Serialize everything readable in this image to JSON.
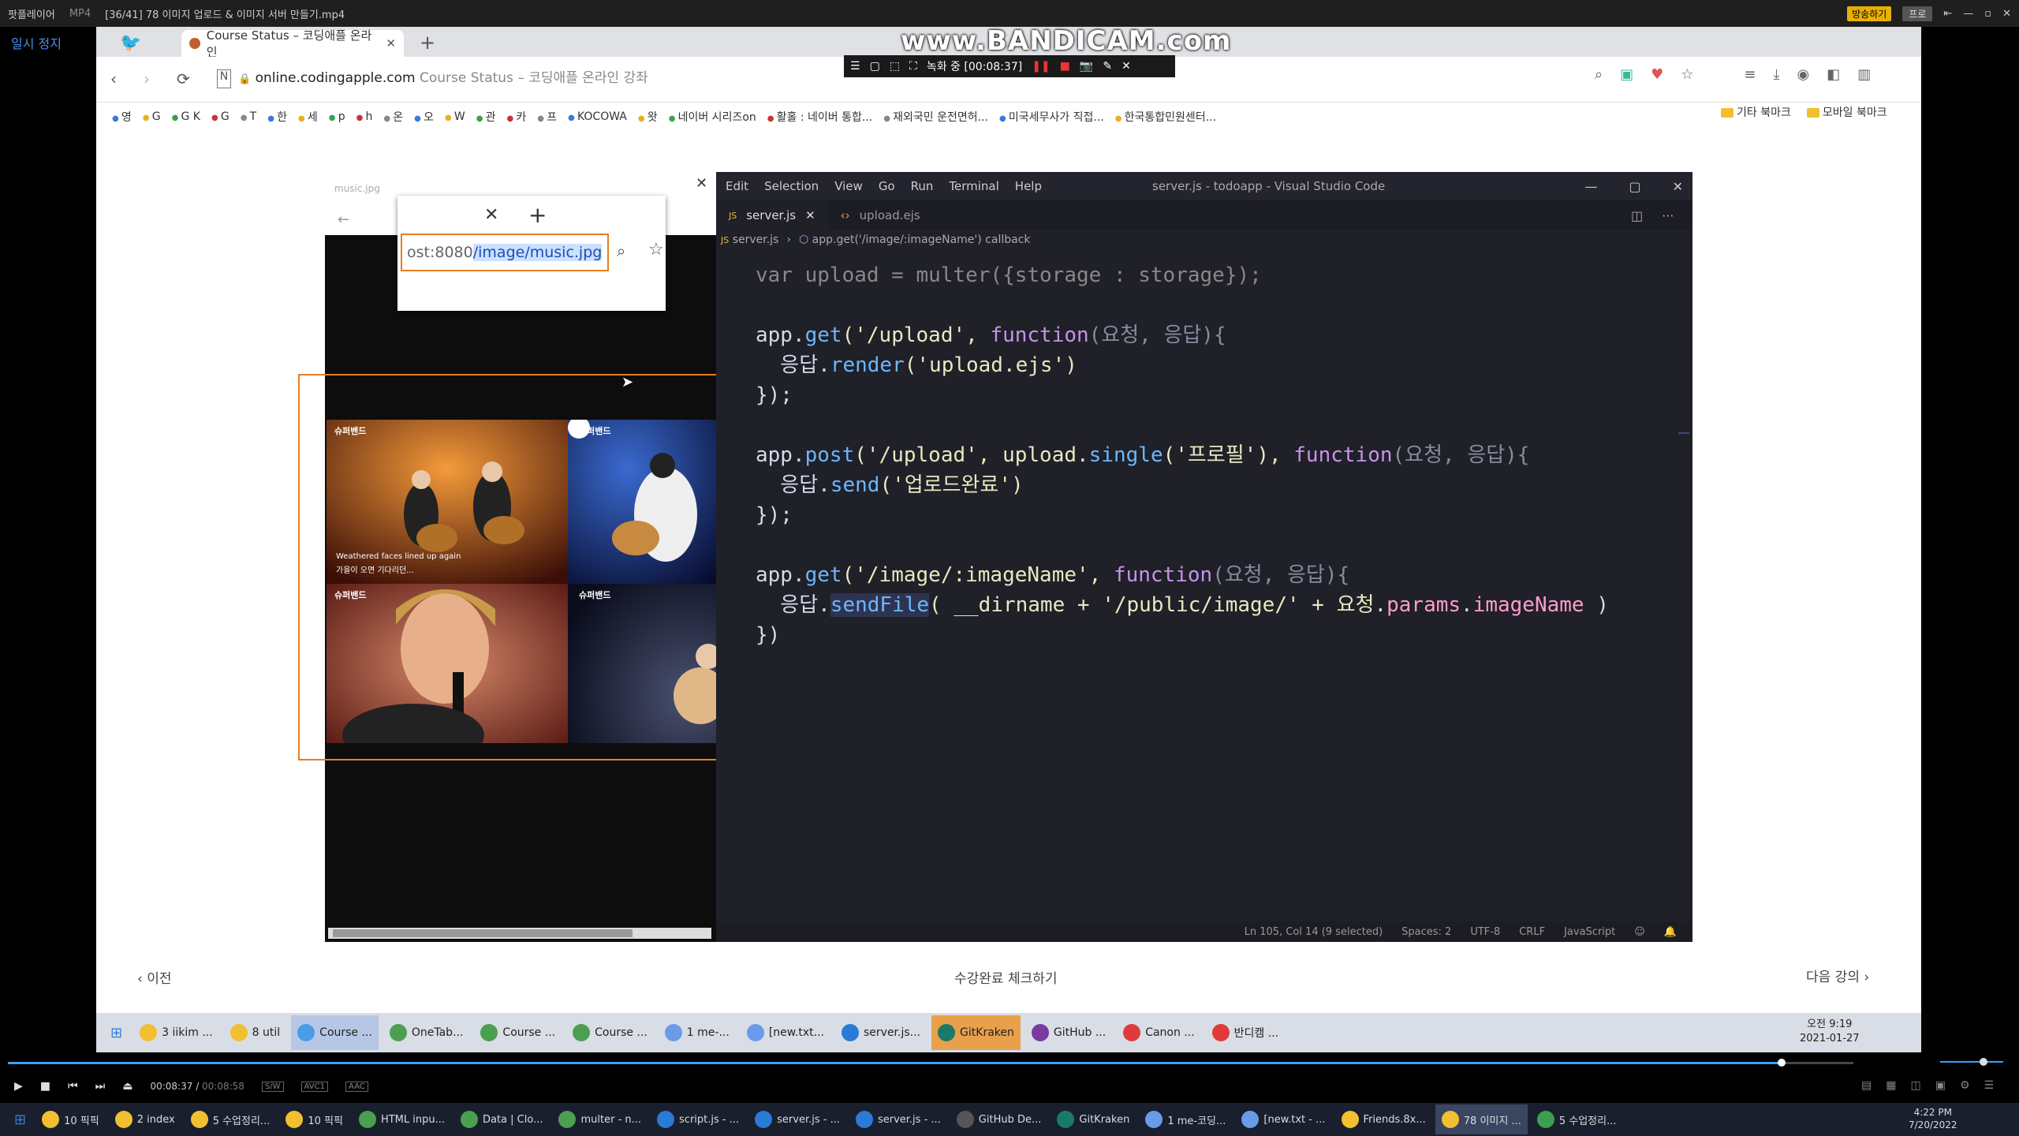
{
  "player": {
    "menu_label": "팟플레이어",
    "format": "MP4",
    "file_title": "[36/41] 78 이미지 업로드 & 이미지 서버 만들기.mp4",
    "badge_broadcast": "방송하기",
    "badge_other": "프로",
    "pause_label": "일시 정지",
    "time_current": "00:08:37",
    "time_total": "00:08:58",
    "tag_sw": "S/W",
    "tag_video": "AVC1",
    "tag_audio": "AAC",
    "progress_fraction": 0.961
  },
  "bandicam": {
    "logo": "www.BANDICAM.com",
    "recording_label": "녹화 중 [00:08:37]"
  },
  "browser": {
    "tab_title": "Course Status – 코딩애플 온라인",
    "url_host": "online.codingapple.com",
    "url_title": "Course Status – 코딩애플 온라인 강좌",
    "bookmarks": [
      "영",
      "G",
      "G K",
      "G",
      "T",
      "한",
      "세",
      "p",
      "h",
      "온",
      "오",
      "W",
      "관",
      "카",
      "프",
      "KOCOWA",
      "왓",
      "네이버 시리즈on",
      "활홀 : 네이버 통합...",
      "재외국민 운전면허...",
      "미국세무사가 직접...",
      "한국통합민원센터..."
    ],
    "bookmark_other": "기타 북마크",
    "bookmark_mobile": "모바일 북마크"
  },
  "mini_browser": {
    "tab_label": "music.jpg",
    "url_prefix": "ost:8080",
    "url_selected": "/image/music.jpg"
  },
  "concert_captions": {
    "logo": "슈퍼밴드",
    "subtitle1": "Weathered faces lined up again",
    "subtitle2": "가을이 오면 기다리던..."
  },
  "vscode": {
    "menu": [
      "Edit",
      "Selection",
      "View",
      "Go",
      "Run",
      "Terminal",
      "Help"
    ],
    "window_title": "server.js - todoapp - Visual Studio Code",
    "tabs": [
      "server.js",
      "upload.ejs"
    ],
    "breadcrumb_file": "server.js",
    "breadcrumb_symbol": "app.get('/image/:imageName') callback",
    "status": [
      "Ln 105, Col 14 (9 selected)",
      "Spaces: 2",
      "UTF-8",
      "CRLF",
      "JavaScript"
    ]
  },
  "code": {
    "l0_a": "var upload = multer({storage : storage});",
    "l1_obj": "app.",
    "l1_fn": "get",
    "l1_rest": "('/upload', ",
    "l1_kw": "function",
    "l1_params": "(요청, 응답){",
    "l2_obj": "  응답.",
    "l2_fn": "render",
    "l2_rest": "('upload.ejs')",
    "l3": "});",
    "l4_obj": "app.",
    "l4_fn": "post",
    "l4_rest": "('/upload', upload.",
    "l4_fn2": "single",
    "l4_rest2": "('프로필'), ",
    "l4_kw": "function",
    "l4_params": "(요청, 응답){",
    "l5_obj": "  응답.",
    "l5_fn": "send",
    "l5_rest": "('업로드완료')",
    "l6": "});",
    "l7_obj": "app.",
    "l7_fn": "get",
    "l7_rest": "('/image/:imageName', ",
    "l7_kw": "function",
    "l7_params": "(요청, 응답){",
    "l8_obj": "  응답.",
    "l8_fn": "sendFile",
    "l8_rest": "( __dirname + '/public/image/' + 요청.",
    "l8_prop": "params",
    "l8_dot": ".",
    "l8_prop2": "imageName",
    "l8_end": " )",
    "l9": "})"
  },
  "course_nav": {
    "prev": "이전",
    "complete": "수강완료 체크하기",
    "next": "다음 강의"
  },
  "inner_taskbar": {
    "items": [
      "3 iikim ...",
      "8 util",
      "Course ...",
      "OneTab...",
      "Course ...",
      "Course ...",
      "1 me-...",
      "[new.txt...",
      "server.js...",
      "GitKraken",
      "GitHub ...",
      "Canon ...",
      "반디캠 ..."
    ],
    "time": "오전 9:19",
    "date": "2021-01-27"
  },
  "outer_taskbar": {
    "items": [
      "10 픽픽",
      "2 index",
      "5 수업정리...",
      "10 픽픽",
      "HTML inpu...",
      "Data | Clo...",
      "multer - n...",
      "script.js - ...",
      "server.js - ...",
      "server.js - ...",
      "GitHub De...",
      "GitKraken",
      "1 me-코딩...",
      "[new.txt - ...",
      "Friends.8x...",
      "78 이미지 ...",
      "5 수업정리..."
    ],
    "time": "4:22 PM",
    "date": "7/20/2022"
  },
  "colors": {
    "highlight": "#e67e22",
    "vscode_bg": "#1f2028",
    "function": "#6cb6ff",
    "keyword": "#c792ea",
    "property": "#ff9ccf"
  }
}
